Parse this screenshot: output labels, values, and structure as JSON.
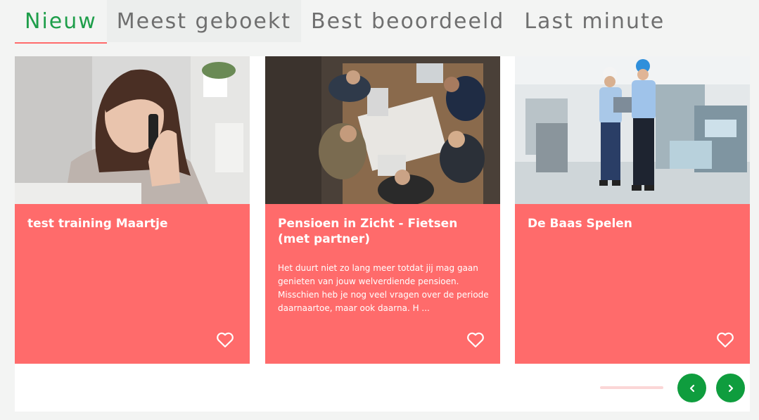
{
  "tabs": [
    {
      "label": "Nieuw",
      "active": true
    },
    {
      "label": "Meest geboekt",
      "active": false
    },
    {
      "label": "Best beoordeeld",
      "active": false
    },
    {
      "label": "Last minute",
      "active": false
    }
  ],
  "cards": [
    {
      "title": "test training Maartje",
      "description": "",
      "image": "woman-on-phone-photo",
      "icon": "heart-outline-icon"
    },
    {
      "title": "Pensioen in Zicht - Fietsen (met partner)",
      "description": "Het duurt niet zo lang meer totdat jij mag gaan genieten van jouw welverdiende pensioen. Misschien heb je nog veel vragen over de periode daarnaartoe, maar ook daarna. H ...",
      "image": "meeting-table-photo",
      "icon": "heart-outline-icon"
    },
    {
      "title": "De Baas Spelen",
      "description": "",
      "image": "factory-engineers-photo",
      "icon": "heart-outline-icon"
    }
  ],
  "carousel": {
    "prev_icon": "chevron-left-icon",
    "next_icon": "chevron-right-icon"
  },
  "colors": {
    "accent": "#1e9e4a",
    "card": "#ff6b6b",
    "button": "#0f9d3e",
    "progress": "#fbd6d6"
  }
}
